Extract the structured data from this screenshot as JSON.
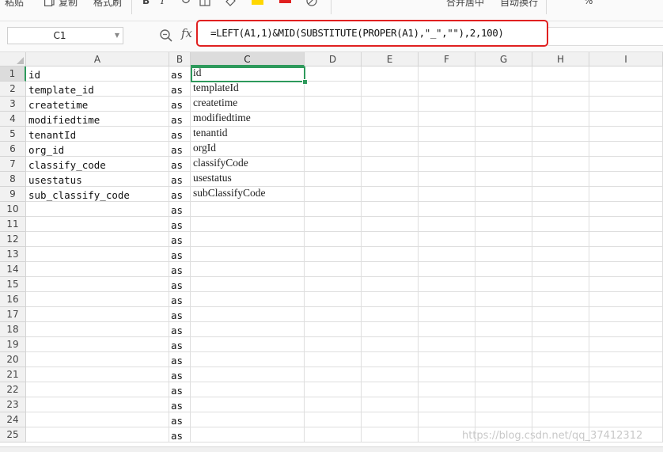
{
  "ribbon": {
    "paste_label": "粘贴",
    "copy_label": "复制",
    "format_painter_label": "格式刷",
    "bold_label": "B",
    "italic_label": "I",
    "merge_center_label": "合并居中",
    "auto_wrap_label": "自动换行",
    "percent_label": "%",
    "font_color": "#e02020",
    "highlight_color": "#ffd700"
  },
  "formula_bar": {
    "name_box": "C1",
    "fx_label": "fx",
    "formula": "=LEFT(A1,1)&MID(SUBSTITUTE(PROPER(A1),\"_\",\"\"),2,100)",
    "highlight_color": "#e02020"
  },
  "grid": {
    "columns": [
      "A",
      "B",
      "C",
      "D",
      "E",
      "F",
      "G",
      "H",
      "I"
    ],
    "selected_column": "C",
    "selected_row": "1",
    "selected_cell": "C1",
    "rows": [
      {
        "n": "1",
        "a": "id",
        "b": "as",
        "c": "id"
      },
      {
        "n": "2",
        "a": "template_id",
        "b": "as",
        "c": "templateId"
      },
      {
        "n": "3",
        "a": "createtime",
        "b": "as",
        "c": "createtime"
      },
      {
        "n": "4",
        "a": "modifiedtime",
        "b": "as",
        "c": "modifiedtime"
      },
      {
        "n": "5",
        "a": "tenantId",
        "b": "as",
        "c": "tenantid"
      },
      {
        "n": "6",
        "a": "org_id",
        "b": "as",
        "c": "orgId"
      },
      {
        "n": "7",
        "a": "classify_code",
        "b": "as",
        "c": "classifyCode"
      },
      {
        "n": "8",
        "a": "usestatus",
        "b": "as",
        "c": "usestatus"
      },
      {
        "n": "9",
        "a": "sub_classify_code",
        "b": "as",
        "c": "subClassifyCode"
      },
      {
        "n": "10",
        "a": "",
        "b": "as",
        "c": ""
      },
      {
        "n": "11",
        "a": "",
        "b": "as",
        "c": ""
      },
      {
        "n": "12",
        "a": "",
        "b": "as",
        "c": ""
      },
      {
        "n": "13",
        "a": "",
        "b": "as",
        "c": ""
      },
      {
        "n": "14",
        "a": "",
        "b": "as",
        "c": ""
      },
      {
        "n": "15",
        "a": "",
        "b": "as",
        "c": ""
      },
      {
        "n": "16",
        "a": "",
        "b": "as",
        "c": ""
      },
      {
        "n": "17",
        "a": "",
        "b": "as",
        "c": ""
      },
      {
        "n": "18",
        "a": "",
        "b": "as",
        "c": ""
      },
      {
        "n": "19",
        "a": "",
        "b": "as",
        "c": ""
      },
      {
        "n": "20",
        "a": "",
        "b": "as",
        "c": ""
      },
      {
        "n": "21",
        "a": "",
        "b": "as",
        "c": ""
      },
      {
        "n": "22",
        "a": "",
        "b": "as",
        "c": ""
      },
      {
        "n": "23",
        "a": "",
        "b": "as",
        "c": ""
      },
      {
        "n": "24",
        "a": "",
        "b": "as",
        "c": ""
      },
      {
        "n": "25",
        "a": "",
        "b": "as",
        "c": ""
      }
    ]
  },
  "watermark": "https://blog.csdn.net/qq_37412312"
}
